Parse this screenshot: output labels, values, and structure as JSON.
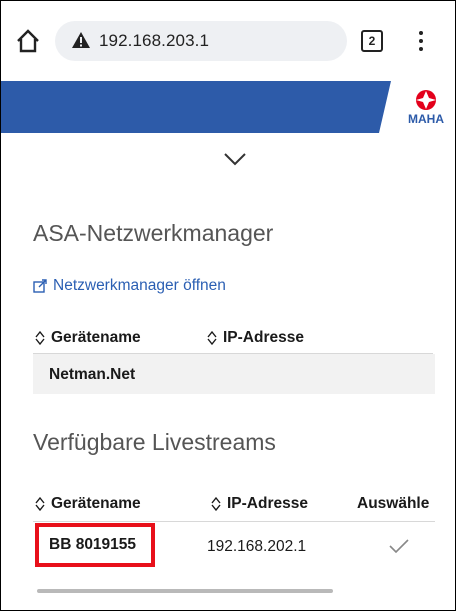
{
  "browser": {
    "url": "192.168.203.1",
    "tab_count": "2"
  },
  "site": {
    "logo_text": "MAHA",
    "colors": {
      "header_blue": "#2d5ba9",
      "logo_red": "#e3001b",
      "highlight_red": "#e8101a",
      "link_blue": "#2b5fb3"
    }
  },
  "network_manager": {
    "title": "ASA-Netzwerkmanager",
    "link_label": "Netzwerkmanager öffnen",
    "columns": [
      "Gerätename",
      "IP-Adresse"
    ],
    "rows": [
      {
        "name": "Netman.Net"
      }
    ]
  },
  "livestreams": {
    "title": "Verfügbare Livestreams",
    "columns": [
      "Gerätename",
      "IP-Adresse",
      "Auswähle"
    ],
    "rows": [
      {
        "name": "BB 8019155",
        "ip": "192.168.202.1",
        "selected": true
      }
    ]
  },
  "icons": [
    "home-icon",
    "warning-icon",
    "tab-switcher-icon",
    "more-vert-icon",
    "chevron-down-icon",
    "external-link-icon",
    "sort-icon",
    "checkmark-icon"
  ]
}
